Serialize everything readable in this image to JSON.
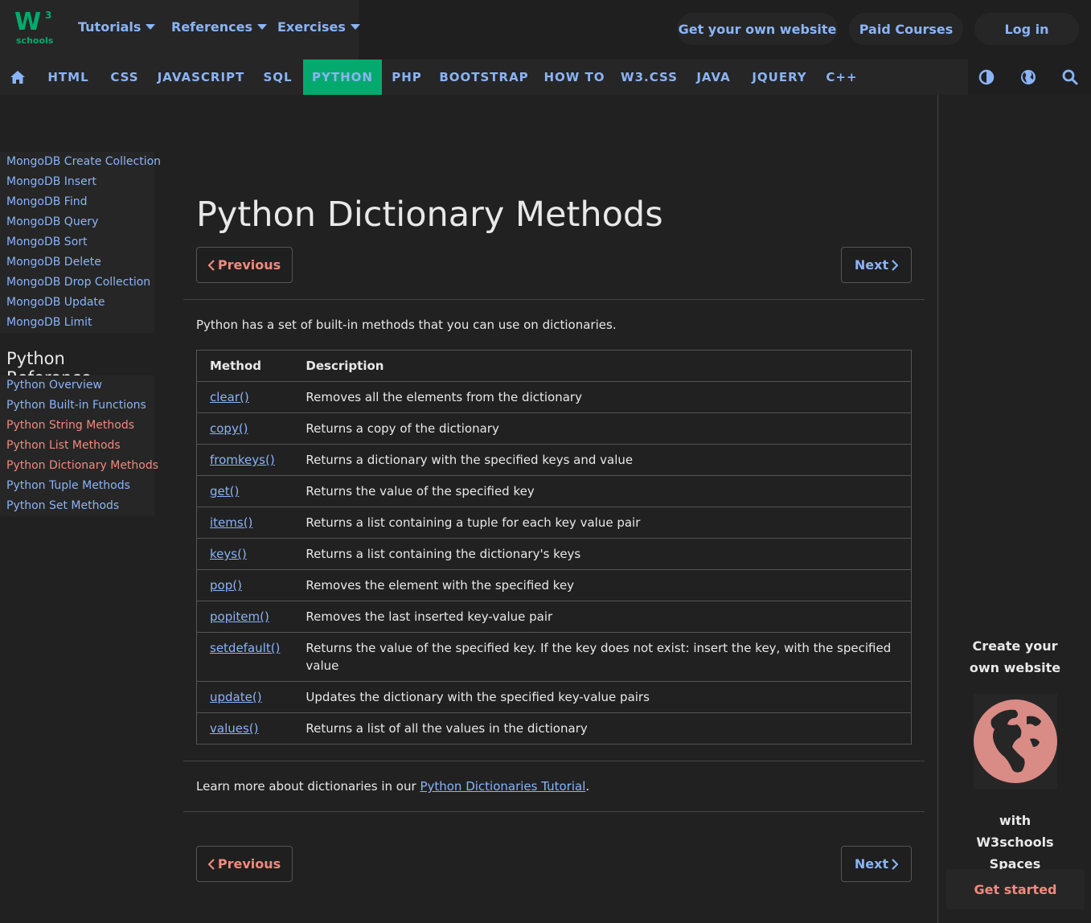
{
  "logo": {
    "mark": "W",
    "superscript": "3",
    "text": "schools"
  },
  "topnav": {
    "tutorials": "Tutorials",
    "references": "References",
    "exercises": "Exercises",
    "get_website": "Get your own website",
    "paid_courses": "Paid Courses",
    "login": "Log in"
  },
  "subnav": {
    "items": [
      "HTML",
      "CSS",
      "JAVASCRIPT",
      "SQL",
      "PYTHON",
      "PHP",
      "BOOTSTRAP",
      "HOW TO",
      "W3.CSS",
      "JAVA",
      "JQUERY",
      "C++"
    ],
    "active": "PYTHON",
    "icons": [
      "home-icon",
      "contrast-icon",
      "globe-icon",
      "search-icon"
    ]
  },
  "sidebar": {
    "mongo_links": [
      "MongoDB Create Collection",
      "MongoDB Insert",
      "MongoDB Find",
      "MongoDB Query",
      "MongoDB Sort",
      "MongoDB Delete",
      "MongoDB Drop Collection",
      "MongoDB Update",
      "MongoDB Limit"
    ],
    "heading": "Python Reference",
    "ref_links": [
      "Python Overview",
      "Python Built-in Functions",
      "Python String Methods",
      "Python List Methods",
      "Python Dictionary Methods",
      "Python Tuple Methods",
      "Python Set Methods"
    ]
  },
  "main": {
    "title": "Python Dictionary Methods",
    "prev_label": "Previous",
    "next_label": "Next",
    "intro": "Python has a set of built-in methods that you can use on dictionaries.",
    "table": {
      "headers": [
        "Method",
        "Description"
      ],
      "rows": [
        [
          "clear()",
          "Removes all the elements from the dictionary"
        ],
        [
          "copy()",
          "Returns a copy of the dictionary"
        ],
        [
          "fromkeys()",
          "Returns a dictionary with the specified keys and value"
        ],
        [
          "get()",
          "Returns the value of the specified key"
        ],
        [
          "items()",
          "Returns a list containing a tuple for each key value pair"
        ],
        [
          "keys()",
          "Returns a list containing the dictionary's keys"
        ],
        [
          "pop()",
          "Removes the element with the specified key"
        ],
        [
          "popitem()",
          "Removes the last inserted key-value pair"
        ],
        [
          "setdefault()",
          "Returns the value of the specified key. If the key does not exist: insert the key, with the specified value"
        ],
        [
          "update()",
          "Updates the dictionary with the specified key-value pairs"
        ],
        [
          "values()",
          "Returns a list of all the values in the dictionary"
        ]
      ]
    },
    "more_prefix": "Learn more about dictionaries in our ",
    "more_link": "Python Dictionaries Tutorial",
    "more_suffix": "."
  },
  "ad": {
    "line1": "Create your own website",
    "line2": "with W3schools Spaces",
    "cta": "Get started"
  },
  "colors": {
    "accent": "#04AA6D",
    "link": "#8ab4f8",
    "salmon": "#f08a7e",
    "globe": "#d98b86"
  }
}
